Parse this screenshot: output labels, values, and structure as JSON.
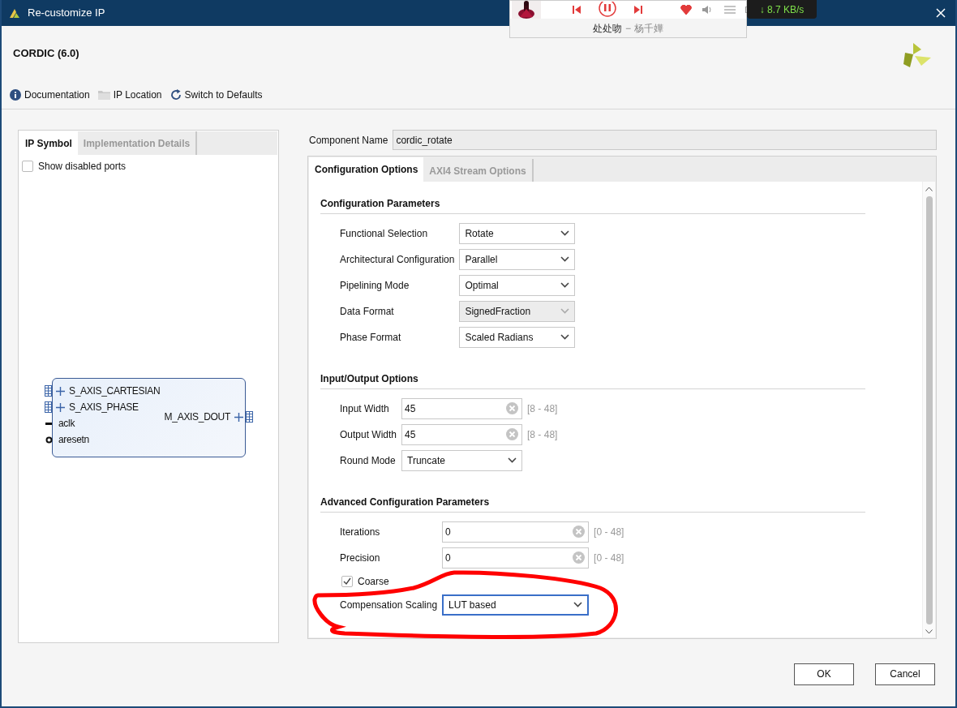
{
  "window": {
    "title": "Re-customize IP"
  },
  "player": {
    "song": "处处吻",
    "separator": "−",
    "artist": "杨千嬅",
    "playing": true,
    "liked": true,
    "speed": "↓ 8.7 KB/s"
  },
  "header": {
    "title": "CORDIC (6.0)"
  },
  "toolbar": [
    {
      "kind": "info",
      "label": "Documentation"
    },
    {
      "kind": "folder",
      "label": "IP Location"
    },
    {
      "kind": "refresh",
      "label": "Switch to Defaults"
    }
  ],
  "left_panel": {
    "tabs": [
      {
        "label": "IP Symbol",
        "selected": true
      },
      {
        "label": "Implementation Details",
        "selected": false
      }
    ],
    "show_disabled_ports": {
      "label": "Show disabled ports",
      "checked": false
    },
    "symbol": {
      "inputs": [
        {
          "kind": "bus",
          "name": "S_AXIS_CARTESIAN"
        },
        {
          "kind": "bus",
          "name": "S_AXIS_PHASE"
        },
        {
          "kind": "clock",
          "name": "aclk"
        },
        {
          "kind": "reset",
          "name": "aresetn"
        }
      ],
      "outputs": [
        {
          "kind": "bus",
          "name": "M_AXIS_DOUT"
        }
      ]
    }
  },
  "component_name": {
    "label": "Component Name",
    "value": "cordic_rotate"
  },
  "right_panel": {
    "tabs": [
      {
        "label": "Configuration Options",
        "selected": true
      },
      {
        "label": "AXI4 Stream Options",
        "selected": false
      }
    ],
    "sections": [
      {
        "title": "Configuration Parameters",
        "items": [
          {
            "kind": "select",
            "label": "Functional Selection",
            "value": "Rotate",
            "disabled": false,
            "focused": false
          },
          {
            "kind": "select",
            "label": "Architectural Configuration",
            "value": "Parallel",
            "disabled": false,
            "focused": false
          },
          {
            "kind": "select",
            "label": "Pipelining Mode",
            "value": "Optimal",
            "disabled": false,
            "focused": false
          },
          {
            "kind": "select",
            "label": "Data Format",
            "value": "SignedFraction",
            "disabled": true,
            "focused": false
          },
          {
            "kind": "select",
            "label": "Phase Format",
            "value": "Scaled Radians",
            "disabled": false,
            "focused": false
          }
        ]
      },
      {
        "title": "Input/Output Options",
        "items": [
          {
            "kind": "text",
            "label": "Input Width",
            "value": "45",
            "range": "[8 - 48]"
          },
          {
            "kind": "text",
            "label": "Output Width",
            "value": "45",
            "range": "[8 - 48]"
          },
          {
            "kind": "select",
            "label": "Round Mode",
            "value": "Truncate",
            "disabled": false,
            "focused": false
          }
        ]
      },
      {
        "title": "Advanced Configuration Parameters",
        "items": [
          {
            "kind": "text",
            "label": "Iterations",
            "value": "0",
            "range": "[0 - 48]"
          },
          {
            "kind": "text",
            "label": "Precision",
            "value": "0",
            "range": "[0 - 48]"
          },
          {
            "kind": "checkbox",
            "label": "Coarse",
            "checked": true
          },
          {
            "kind": "select",
            "label": "Compensation Scaling",
            "value": "LUT based",
            "disabled": false,
            "focused": true
          }
        ]
      }
    ]
  },
  "buttons": [
    "OK",
    "Cancel"
  ]
}
